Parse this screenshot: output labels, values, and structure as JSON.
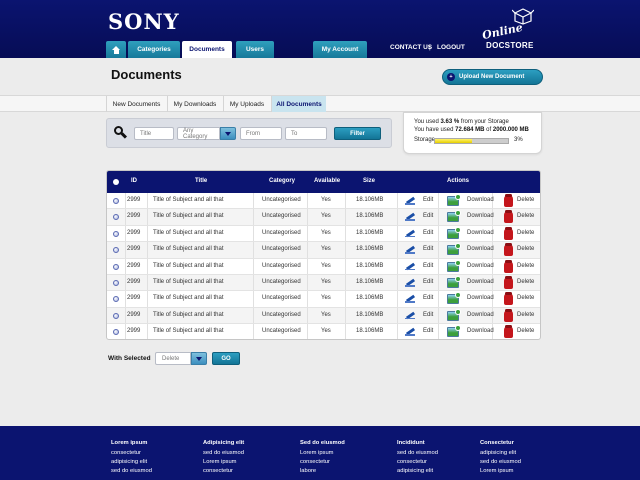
{
  "brand": {
    "logo": "SONY",
    "docstore_script": "Online",
    "docstore_name": "DOCSTORE"
  },
  "nav": {
    "tabs": [
      "Categories",
      "Documents",
      "Users"
    ],
    "my_account": "My Account",
    "contact": "CONTACT US",
    "separator": "|",
    "logout": "LOGOUT"
  },
  "page": {
    "title": "Documents",
    "upload_label": "Upload New Document"
  },
  "subtabs": [
    "New Documents",
    "My Downloads",
    "My Uploads",
    "All Documents"
  ],
  "filter": {
    "title_placeholder": "Title",
    "category_value": "Any Category",
    "from_placeholder": "From",
    "to_placeholder": "To",
    "button": "Filter"
  },
  "storage": {
    "line1_pre": "You used ",
    "line1_value": "3.63 %",
    "line1_post": " from your Storage",
    "line2_pre": "You have used ",
    "line2_value": "72.684 MB",
    "line2_mid": " of ",
    "line2_total": "2000.000 MB",
    "label": "Storage",
    "percent_text": "3%",
    "fill_fraction": 0.5
  },
  "table": {
    "headers": {
      "id": "ID",
      "title": "Title",
      "category": "Category",
      "available": "Available",
      "size": "Size",
      "actions": "Actions"
    },
    "action_labels": {
      "edit": "Edit",
      "download": "Download",
      "delete": "Delete"
    },
    "rows": [
      {
        "id": "2999",
        "title": "Title of Subject and all that",
        "category": "Uncategorised",
        "available": "Yes",
        "size": "18.106MB"
      },
      {
        "id": "2999",
        "title": "Title of Subject and all that",
        "category": "Uncategorised",
        "available": "Yes",
        "size": "18.106MB"
      },
      {
        "id": "2999",
        "title": "Title of Subject and all that",
        "category": "Uncategorised",
        "available": "Yes",
        "size": "18.106MB"
      },
      {
        "id": "2999",
        "title": "Title of Subject and all that",
        "category": "Uncategorised",
        "available": "Yes",
        "size": "18.106MB"
      },
      {
        "id": "2999",
        "title": "Title of Subject and all that",
        "category": "Uncategorised",
        "available": "Yes",
        "size": "18.106MB"
      },
      {
        "id": "2999",
        "title": "Title of Subject and all that",
        "category": "Uncategorised",
        "available": "Yes",
        "size": "18.106MB"
      },
      {
        "id": "2999",
        "title": "Title of Subject and all that",
        "category": "Uncategorised",
        "available": "Yes",
        "size": "18.106MB"
      },
      {
        "id": "2999",
        "title": "Title of Subject and all that",
        "category": "Uncategorised",
        "available": "Yes",
        "size": "18.106MB"
      },
      {
        "id": "2999",
        "title": "Title of Subject and all that",
        "category": "Uncategorised",
        "available": "Yes",
        "size": "18.106MB"
      }
    ]
  },
  "bulk": {
    "label": "With Selected",
    "select_value": "Delete",
    "go": "GO"
  },
  "footer": {
    "columns": [
      {
        "heading": "Lorem ipsum",
        "items": [
          "consectetur",
          "adipisicing elit",
          "sed do eiusmod"
        ]
      },
      {
        "heading": "Adipisicing elit",
        "items": [
          "sed do eiusmod",
          "Lorem ipsum",
          "consectetur"
        ]
      },
      {
        "heading": "Sed do eiusmod",
        "items": [
          "Lorem ipsum",
          "consectetur",
          "labore"
        ]
      },
      {
        "heading": "Incididunt",
        "items": [
          "sed do eiusmod",
          "consectetur",
          "adipisicing elit"
        ]
      },
      {
        "heading": "Consectetur",
        "items": [
          "adipisicing elit",
          "sed do eiusmod",
          "Lorem ipsum"
        ]
      }
    ]
  },
  "colors": {
    "navy": "#0b1470",
    "teal": "#1d88ab",
    "tab_active_bg": "#c9e4ef",
    "storage_fill": "#f2df1a"
  }
}
